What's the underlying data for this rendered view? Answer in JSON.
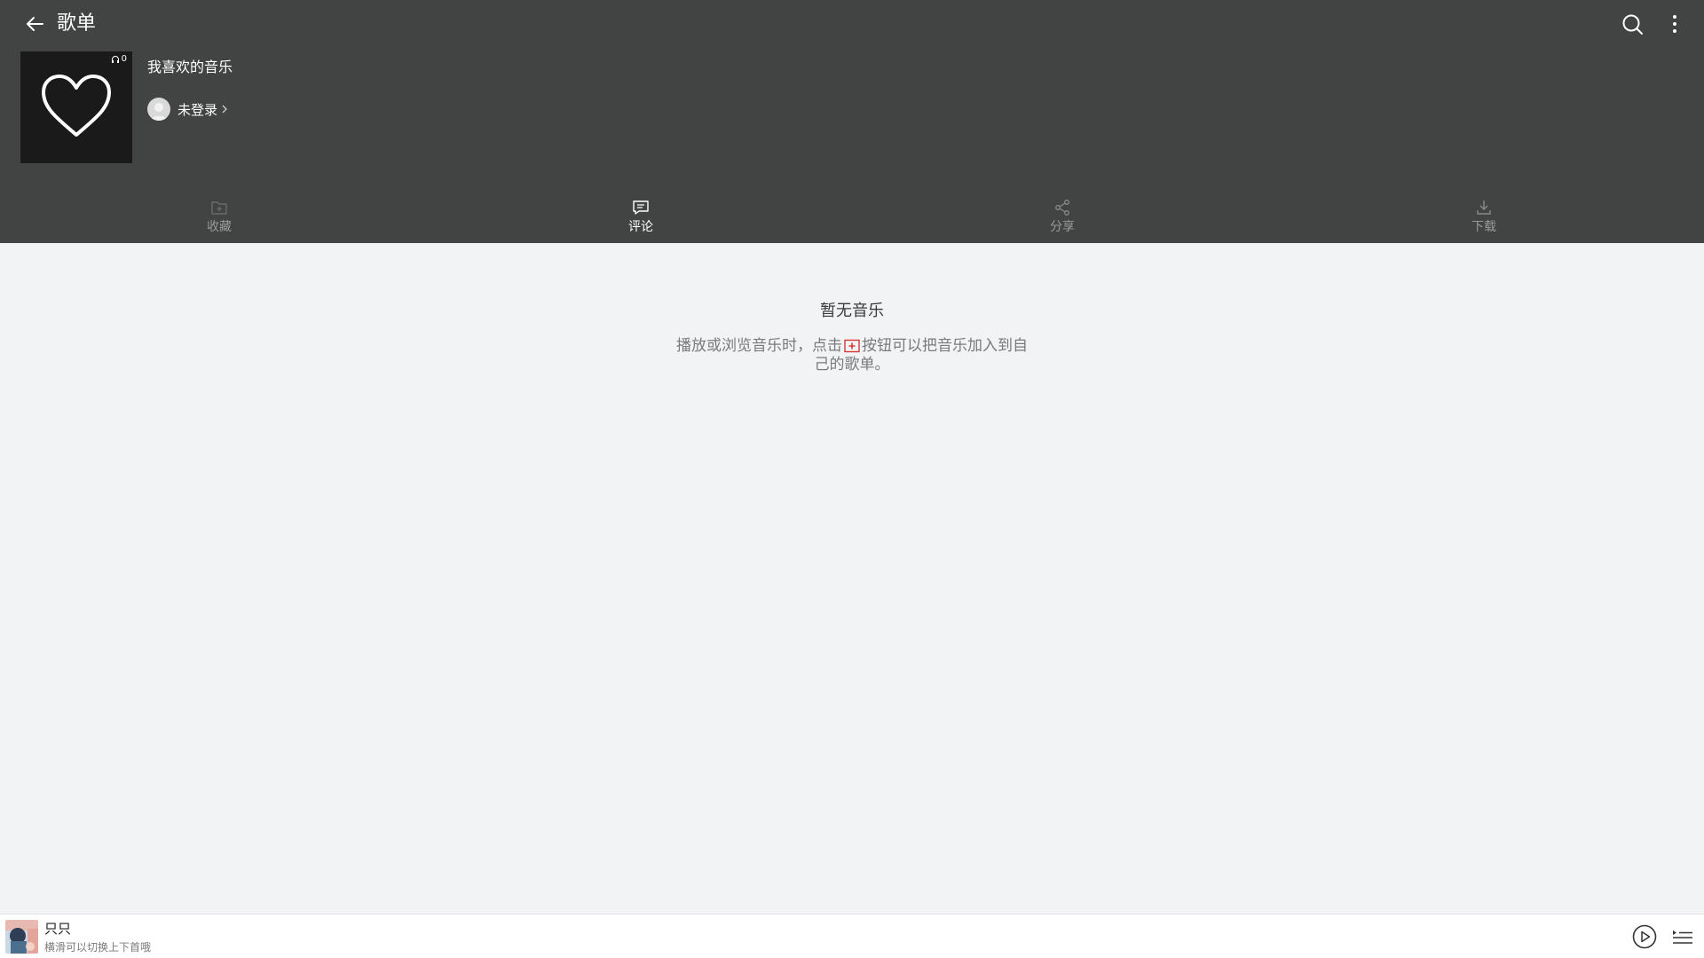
{
  "topbar": {
    "title": "歌单",
    "icons": {
      "back": "back-arrow-icon",
      "search": "search-icon",
      "more": "more-vertical-icon"
    }
  },
  "playlist": {
    "name": "我喜欢的音乐",
    "cover_icon": "heart-icon",
    "play_count": "0",
    "owner": "未登录"
  },
  "actions": [
    {
      "label": "收藏",
      "icon": "favorite-folder-icon"
    },
    {
      "label": "评论",
      "icon": "comment-icon"
    },
    {
      "label": "分享",
      "icon": "share-icon"
    },
    {
      "label": "下载",
      "icon": "download-icon"
    }
  ],
  "empty": {
    "title": "暂无音乐",
    "desc_before": "播放或浏览音乐时，点击",
    "desc_after": "按钮可以把音乐加入到自己的歌单。"
  },
  "player": {
    "song_title": "只只",
    "hint": "横滑可以切换上下首哦",
    "icons": {
      "play": "play-circle-icon",
      "queue": "playlist-queue-icon"
    }
  },
  "colors": {
    "header_bg": "#424343",
    "body_bg": "#f2f3f5",
    "accent_red": "#d33a31"
  }
}
